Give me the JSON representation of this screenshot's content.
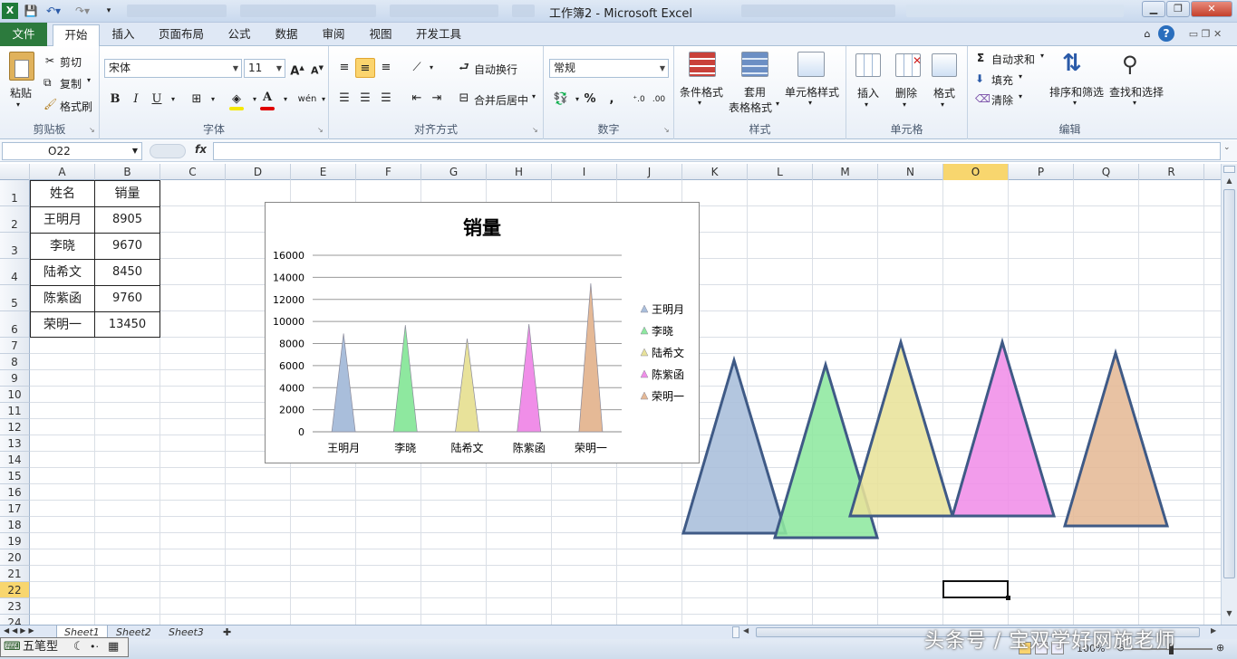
{
  "window": {
    "title": "工作簿2 - Microsoft Excel",
    "quick_access": [
      "save-icon",
      "undo-icon",
      "redo-icon"
    ]
  },
  "tabs": [
    "文件",
    "开始",
    "插入",
    "页面布局",
    "公式",
    "数据",
    "审阅",
    "视图",
    "开发工具"
  ],
  "ribbon": {
    "clipboard": {
      "label": "剪贴板",
      "paste": "粘贴",
      "cut": "剪切",
      "copy": "复制",
      "format_painter": "格式刷"
    },
    "font": {
      "label": "字体",
      "name": "宋体",
      "size": "11"
    },
    "alignment": {
      "label": "对齐方式",
      "wrap": "自动换行",
      "merge": "合并后居中"
    },
    "number": {
      "label": "数字",
      "format": "常规"
    },
    "styles": {
      "label": "样式",
      "conditional": "条件格式",
      "table1": "套用",
      "table2": "表格格式",
      "cell_styles": "单元格样式"
    },
    "cells": {
      "label": "单元格",
      "insert": "插入",
      "delete": "删除",
      "format": "格式"
    },
    "editing": {
      "label": "编辑",
      "autosum": "自动求和",
      "fill": "填充",
      "clear": "清除",
      "sort": "排序和筛选",
      "find": "查找和选择"
    }
  },
  "formula_bar": {
    "name_box": "O22",
    "fx": "fx",
    "content": ""
  },
  "columns": [
    "A",
    "B",
    "C",
    "D",
    "E",
    "F",
    "G",
    "H",
    "I",
    "J",
    "K",
    "L",
    "M",
    "N",
    "O",
    "P",
    "Q",
    "R"
  ],
  "rows": [
    "1",
    "2",
    "3",
    "4",
    "5",
    "6",
    "7",
    "8",
    "9",
    "10",
    "11",
    "12",
    "13",
    "14",
    "15",
    "16",
    "17",
    "18",
    "19",
    "20",
    "21",
    "22",
    "23",
    "24"
  ],
  "table": {
    "header": [
      "姓名",
      "销量"
    ],
    "rows": [
      [
        "王明月",
        "8905"
      ],
      [
        "李晓",
        "9670"
      ],
      [
        "陆希文",
        "8450"
      ],
      [
        "陈紫函",
        "9760"
      ],
      [
        "荣明一",
        "13450"
      ]
    ]
  },
  "chart_data": {
    "type": "bar",
    "title": "销量",
    "categories": [
      "王明月",
      "李晓",
      "陆希文",
      "陈紫函",
      "荣明一"
    ],
    "values": [
      8905,
      9670,
      8450,
      9760,
      13450
    ],
    "yticks": [
      "0",
      "2000",
      "4000",
      "6000",
      "8000",
      "10000",
      "12000",
      "14000",
      "16000"
    ],
    "ylim": [
      0,
      16000
    ],
    "legend": [
      "王明月",
      "李晓",
      "陆希文",
      "陈紫函",
      "荣明一"
    ],
    "legend_position": "right",
    "colors": [
      "#a9bedb",
      "#8ee89f",
      "#e8e29a",
      "#f08ee8",
      "#e5b996"
    ],
    "grid": true
  },
  "shapes_colors": [
    "#a9bedb",
    "#8ee89f",
    "#e8e29a",
    "#f08ee8",
    "#e5b996"
  ],
  "sheet_tabs": [
    "Sheet1",
    "Sheet2",
    "Sheet3"
  ],
  "status": {
    "zoom": "100%",
    "ime": "五笔型"
  },
  "watermark": "头条号 / 宝双学好网施老师"
}
